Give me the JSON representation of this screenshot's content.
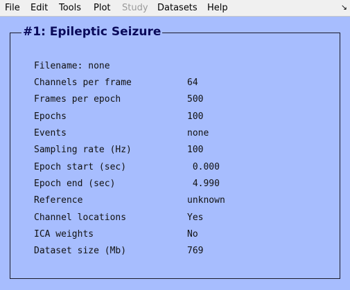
{
  "menubar": {
    "items": [
      {
        "label": "File",
        "enabled": true
      },
      {
        "label": "Edit",
        "enabled": true
      },
      {
        "label": "Tools",
        "enabled": true
      },
      {
        "label": "Plot",
        "enabled": true
      },
      {
        "label": "Study",
        "enabled": false
      },
      {
        "label": "Datasets",
        "enabled": true
      },
      {
        "label": "Help",
        "enabled": true
      }
    ],
    "corner_icon": "↘"
  },
  "panel": {
    "title": "#1: Epileptic Seizure",
    "filename": "Filename: none",
    "rows": [
      {
        "label": "Channels per frame",
        "value": "64"
      },
      {
        "label": "Frames per epoch",
        "value": "500"
      },
      {
        "label": "Epochs",
        "value": "100"
      },
      {
        "label": "Events",
        "value": "none"
      },
      {
        "label": "Sampling rate (Hz)",
        "value": "100"
      },
      {
        "label": "Epoch start (sec)",
        "value": " 0.000"
      },
      {
        "label": "Epoch end (sec)",
        "value": " 4.990"
      },
      {
        "label": "Reference",
        "value": "unknown"
      },
      {
        "label": "Channel locations",
        "value": "Yes"
      },
      {
        "label": "ICA weights",
        "value": "No"
      },
      {
        "label": "Dataset size (Mb)",
        "value": "769"
      }
    ]
  },
  "colors": {
    "background": "#a7bdfe",
    "title": "#0a0a5a",
    "menubar": "#f0f0f0",
    "disabled": "#9b9b9b"
  }
}
